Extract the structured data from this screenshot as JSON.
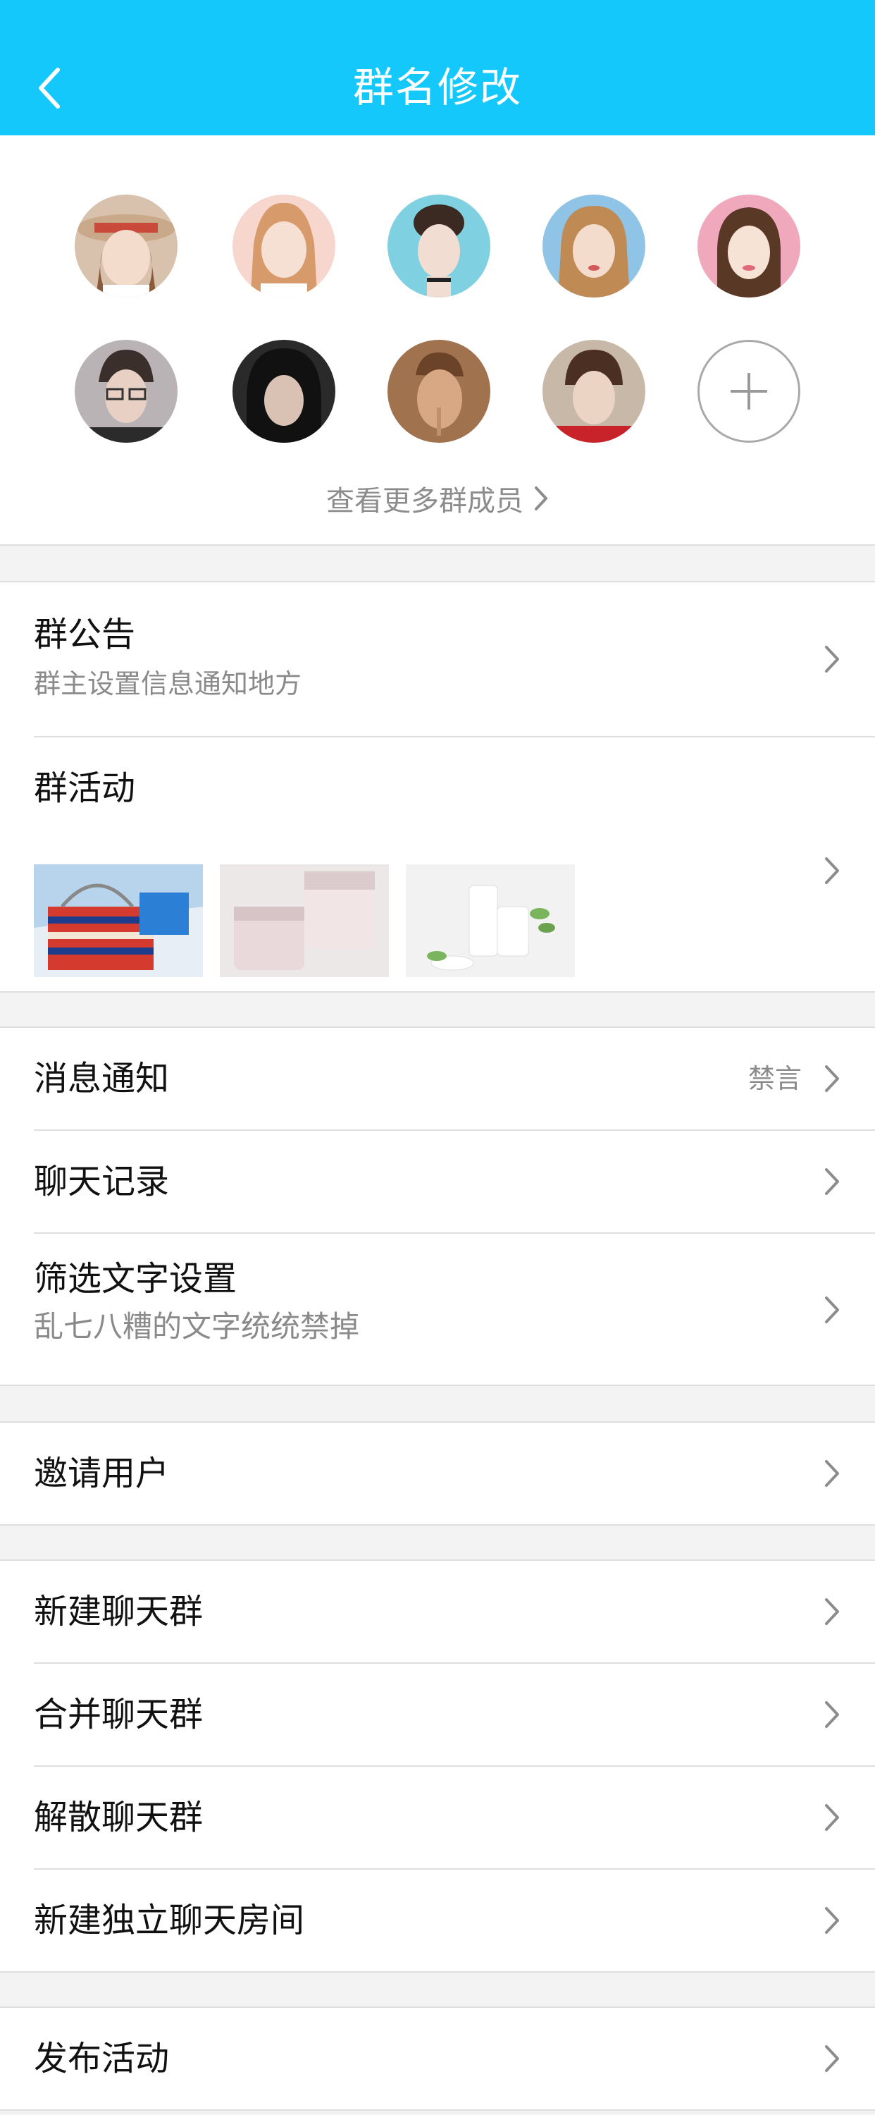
{
  "header": {
    "title": "群名修改",
    "back_icon": "chevron-left-icon",
    "background": "#14c8fb"
  },
  "members": {
    "avatars": [
      {
        "name": "member-avatar-1"
      },
      {
        "name": "member-avatar-2"
      },
      {
        "name": "member-avatar-3"
      },
      {
        "name": "member-avatar-4"
      },
      {
        "name": "member-avatar-5"
      },
      {
        "name": "member-avatar-6"
      },
      {
        "name": "member-avatar-7"
      },
      {
        "name": "member-avatar-8"
      },
      {
        "name": "member-avatar-9"
      }
    ],
    "add_icon": "plus-icon",
    "more_label": "查看更多群成员"
  },
  "announcement": {
    "title": "群公告",
    "subtitle": "群主设置信息通知地方"
  },
  "activity": {
    "title": "群活动",
    "thumbnails": [
      "activity-thumb-bag",
      "activity-thumb-cream",
      "activity-thumb-bottles"
    ]
  },
  "settings": {
    "notify": {
      "title": "消息通知",
      "value": "禁言"
    },
    "history": {
      "title": "聊天记录"
    },
    "filter": {
      "title": "筛选文字设置",
      "subtitle": "乱七八糟的文字统统禁掉"
    }
  },
  "invite": {
    "title": "邀请用户"
  },
  "groups": {
    "create": "新建聊天群",
    "merge": "合并聊天群",
    "dissolve": "解散聊天群",
    "room": "新建独立聊天房间"
  },
  "publish": {
    "title": "发布活动"
  }
}
